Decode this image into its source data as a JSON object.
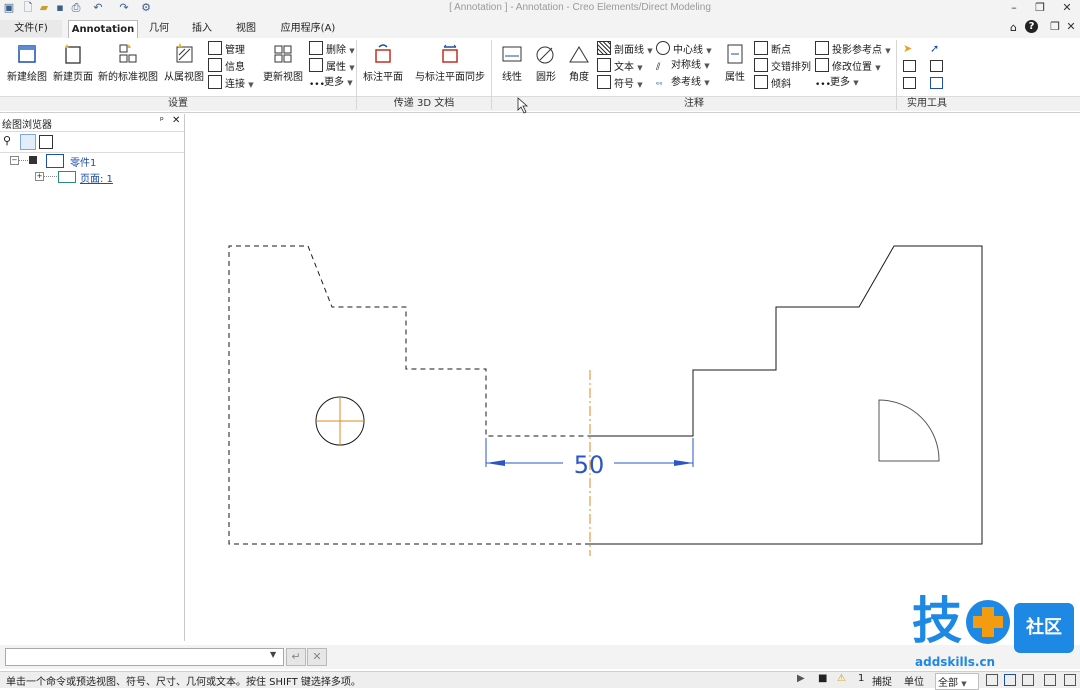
{
  "window": {
    "title": "[ Annotation ] - Annotation - Creo Elements/Direct Modeling",
    "controls": [
      "–",
      "❐",
      "✕"
    ]
  },
  "menu": {
    "file": "文件(F)",
    "tabs": [
      "Annotation",
      "几何",
      "插入",
      "视图",
      "应用程序(A)"
    ],
    "active_tab": "Annotation",
    "right_icons": [
      "⌂",
      "?"
    ]
  },
  "ribbon": {
    "setup": {
      "label": "设置",
      "new_drawing": "新建绘图",
      "new_page": "新建页面",
      "new_std_view": "新的标准视图",
      "from_view": "从属视图",
      "manage": "管理",
      "info": "信息",
      "connect": "连接",
      "update_view": "更新视图",
      "delete": "删除",
      "properties": "属性",
      "more": "更多"
    },
    "transfer3d": {
      "label": "传递 3D 文档",
      "dim_plane": "标注平面",
      "sync_dim_plane": "与标注平面同步"
    },
    "annotation": {
      "label": "注释",
      "linear": "线性",
      "circle": "圆形",
      "angle": "角度",
      "hatch": "剖面线",
      "text": "文本",
      "symbol": "符号",
      "centerline": "中心线",
      "symmetry": "对称线",
      "reference": "参考线",
      "props": "属性",
      "break": "断点",
      "stagger": "交错排列",
      "slant": "倾斜",
      "proj_ref": "投影参考点",
      "modify_pos": "修改位置",
      "more": "更多"
    },
    "tools": {
      "label": "实用工具"
    }
  },
  "browser": {
    "title": "绘图浏览器",
    "tree": [
      {
        "label": "零件1",
        "level": 0
      },
      {
        "label": "页面: 1",
        "level": 1
      }
    ]
  },
  "drawing": {
    "dimension_value": "50",
    "colors": {
      "geometry": "#1a1a1a",
      "hidden": "#1a1a1a",
      "centerline": "#e08a1e",
      "dimension": "#2a56c6"
    }
  },
  "commandline": {
    "value": ""
  },
  "status": {
    "message": "单击一个命令或预选视图、符号、尺寸、几何或文本。按住 SHIFT 键选择多项。",
    "count": "1",
    "snap": "捕捉",
    "units": "单位",
    "filter": "全部"
  },
  "watermark": {
    "text": "技",
    "badge": "社区",
    "url": "addskills.cn"
  }
}
